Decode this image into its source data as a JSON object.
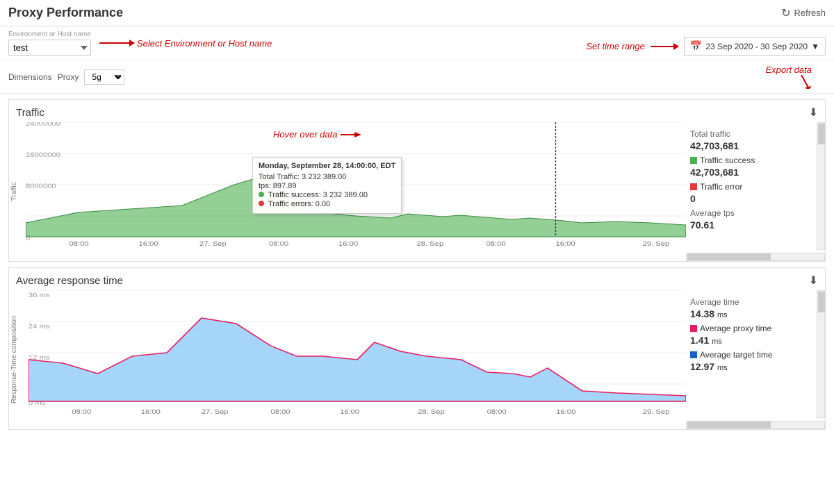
{
  "header": {
    "title": "Proxy Performance",
    "refresh_label": "Refresh"
  },
  "toolbar": {
    "env_label": "Environment or Host name",
    "env_value": "test",
    "env_annotation": "Select Environment or Host name",
    "time_annotation": "Set time range",
    "date_range": "23 Sep 2020 - 30 Sep 2020"
  },
  "dimensions": {
    "label": "Dimensions",
    "proxy_label": "Proxy",
    "proxy_value": "5g",
    "export_label": "Export data"
  },
  "traffic_chart": {
    "title": "Traffic",
    "y_label": "Traffic",
    "download_icon": "⬇",
    "stats": {
      "total_label": "Total traffic",
      "total_value": "42,703,681",
      "success_label": "Traffic success",
      "success_value": "42,703,681",
      "error_label": "Traffic error",
      "error_value": "0",
      "avg_tps_label": "Average tps",
      "avg_tps_value": "70.61"
    },
    "tooltip": {
      "title": "Monday, September 28, 14:00:00, EDT",
      "total": "Total Traffic: 3 232 389.00",
      "tps": "tps: 897.89",
      "success": "Traffic success: 3 232 389.00",
      "errors": "Traffic errors: 0.00"
    },
    "x_labels": [
      "08:00",
      "16:00",
      "27. Sep",
      "08:00",
      "16:00",
      "28. Sep",
      "08:00",
      "16:00",
      "29. Sep"
    ],
    "y_labels": [
      "24000000",
      "16000000",
      "8000000",
      "0"
    ]
  },
  "response_chart": {
    "title": "Average response time",
    "y_label": "Response-Time composition",
    "download_icon": "⬇",
    "stats": {
      "avg_label": "Average time",
      "avg_value": "14.38",
      "avg_unit": "ms",
      "proxy_label": "Average proxy time",
      "proxy_value": "1.41",
      "proxy_unit": "ms",
      "target_label": "Average target time",
      "target_value": "12.97",
      "target_unit": "ms"
    },
    "x_labels": [
      "08:00",
      "16:00",
      "27. Sep",
      "08:00",
      "16:00",
      "28. Sep",
      "08:00",
      "16:00",
      "29. Sep"
    ],
    "y_labels": [
      "36 ms",
      "24 ms",
      "12 ms",
      "0 ms"
    ]
  },
  "hover_annotation": "Hover over data",
  "colors": {
    "traffic_fill": "#4caf50",
    "traffic_stroke": "#388e3c",
    "response_fill": "#90caf9",
    "response_stroke": "#e91e63",
    "error": "#c00"
  }
}
